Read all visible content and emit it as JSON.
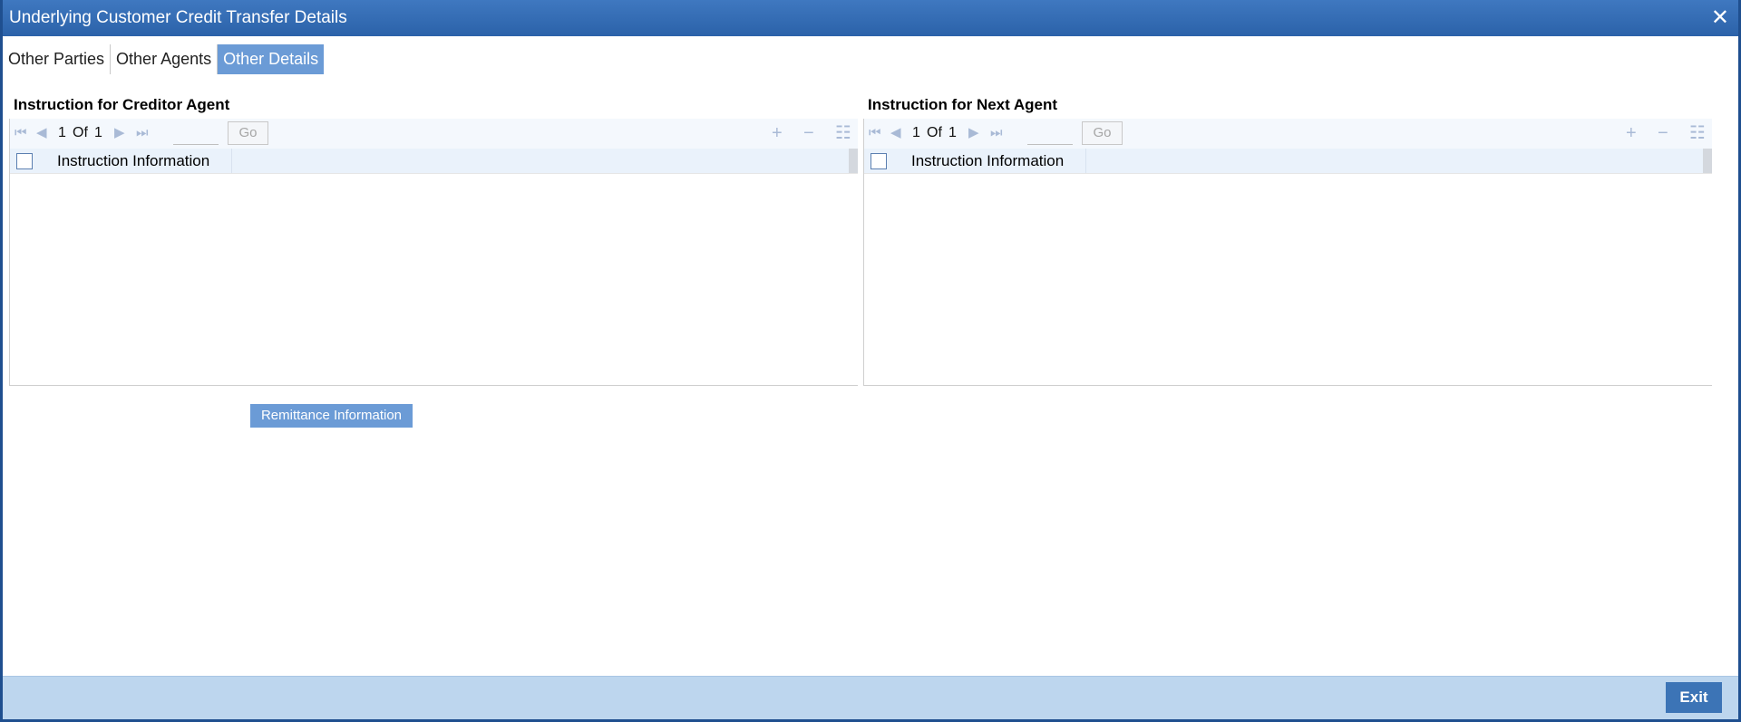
{
  "window": {
    "title": "Underlying Customer Credit Transfer Details",
    "close_glyph": "✕"
  },
  "tabs": [
    {
      "label": "Other Parties",
      "active": false
    },
    {
      "label": "Other Agents",
      "active": false
    },
    {
      "label": "Other Details",
      "active": true
    }
  ],
  "left_panel": {
    "title": "Instruction for Creditor Agent",
    "pager": {
      "current": "1",
      "of_label": "Of",
      "total": "1",
      "go_label": "Go"
    },
    "column_header": "Instruction Information",
    "rows": []
  },
  "right_panel": {
    "title": "Instruction for Next Agent",
    "pager": {
      "current": "1",
      "of_label": "Of",
      "total": "1",
      "go_label": "Go"
    },
    "column_header": "Instruction Information",
    "rows": []
  },
  "icons": {
    "first": "⏮",
    "prev": "◀",
    "next": "▶",
    "last": "⏭",
    "add": "+",
    "delete": "−",
    "view": "☷"
  },
  "buttons": {
    "remittance_label": "Remittance Information",
    "exit_label": "Exit"
  },
  "colors": {
    "title_bar": "#2b62a9",
    "active_tab": "#6b9bd6",
    "footer": "#bdd6ee",
    "exit_button": "#3c74b6"
  }
}
